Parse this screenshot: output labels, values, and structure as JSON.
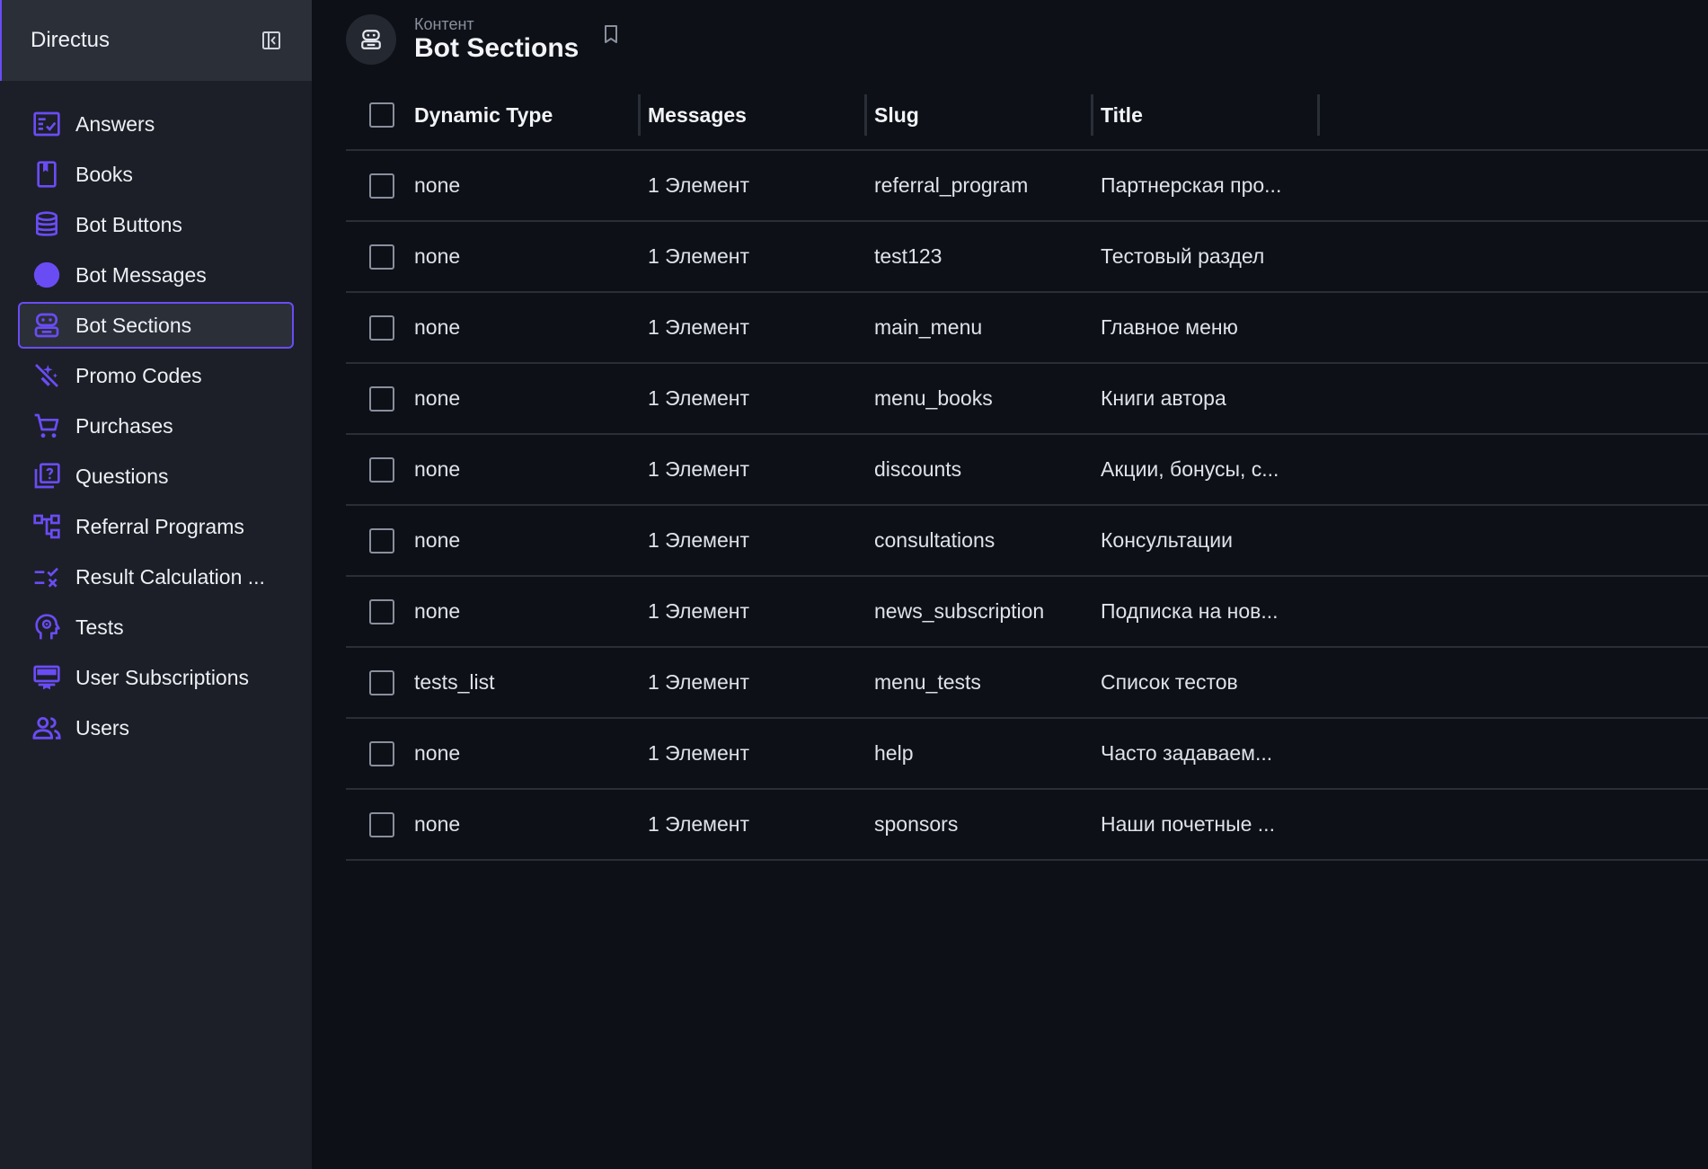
{
  "app": {
    "title": "Directus"
  },
  "sidebar": {
    "items": [
      {
        "label": "Answers",
        "icon": "checklist-icon"
      },
      {
        "label": "Books",
        "icon": "book-icon"
      },
      {
        "label": "Bot Buttons",
        "icon": "database-icon"
      },
      {
        "label": "Bot Messages",
        "icon": "chat-bubble-icon"
      },
      {
        "label": "Bot Sections",
        "icon": "robot-icon",
        "active": true
      },
      {
        "label": "Promo Codes",
        "icon": "magic-wand-off-icon"
      },
      {
        "label": "Purchases",
        "icon": "cart-icon"
      },
      {
        "label": "Questions",
        "icon": "quiz-icon"
      },
      {
        "label": "Referral Programs",
        "icon": "tree-icon"
      },
      {
        "label": "Result Calculation ...",
        "icon": "rule-icon"
      },
      {
        "label": "Tests",
        "icon": "psychology-icon"
      },
      {
        "label": "User Subscriptions",
        "icon": "subscriptions-icon"
      },
      {
        "label": "Users",
        "icon": "group-icon"
      }
    ]
  },
  "header": {
    "breadcrumb": "Контент",
    "title": "Bot Sections"
  },
  "table": {
    "columns": [
      "Dynamic Type",
      "Messages",
      "Slug",
      "Title"
    ],
    "rows": [
      {
        "dynamic_type": "none",
        "messages": "1 Элемент",
        "slug": "referral_program",
        "title": "Партнерская про..."
      },
      {
        "dynamic_type": "none",
        "messages": "1 Элемент",
        "slug": "test123",
        "title": "Тестовый раздел"
      },
      {
        "dynamic_type": "none",
        "messages": "1 Элемент",
        "slug": "main_menu",
        "title": "Главное меню"
      },
      {
        "dynamic_type": "none",
        "messages": "1 Элемент",
        "slug": "menu_books",
        "title": "Книги автора"
      },
      {
        "dynamic_type": "none",
        "messages": "1 Элемент",
        "slug": "discounts",
        "title": "Акции, бонусы, с..."
      },
      {
        "dynamic_type": "none",
        "messages": "1 Элемент",
        "slug": "consultations",
        "title": "Консультации"
      },
      {
        "dynamic_type": "none",
        "messages": "1 Элемент",
        "slug": "news_subscription",
        "title": "Подписка на нов..."
      },
      {
        "dynamic_type": "tests_list",
        "messages": "1 Элемент",
        "slug": "menu_tests",
        "title": "Список тестов"
      },
      {
        "dynamic_type": "none",
        "messages": "1 Элемент",
        "slug": "help",
        "title": "Часто задаваем..."
      },
      {
        "dynamic_type": "none",
        "messages": "1 Элемент",
        "slug": "sponsors",
        "title": "Наши почетные ..."
      }
    ]
  },
  "colors": {
    "accent": "#6a4cf5",
    "sidebar_bg": "#1c1f27",
    "main_bg": "#0d1017"
  }
}
